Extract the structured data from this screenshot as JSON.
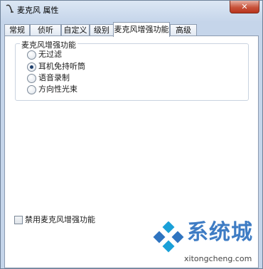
{
  "window": {
    "title": "麦克风 属性",
    "close_label": "✕"
  },
  "tabs": [
    {
      "label": "常规"
    },
    {
      "label": "侦听"
    },
    {
      "label": "自定义"
    },
    {
      "label": "级别"
    },
    {
      "label": "麦克风增强功能",
      "active": true
    },
    {
      "label": "高级"
    }
  ],
  "group": {
    "title": "麦克风增强功能",
    "options": [
      {
        "label": "无过滤",
        "checked": false
      },
      {
        "label": "耳机免持听筒",
        "checked": true
      },
      {
        "label": "语音录制",
        "checked": false
      },
      {
        "label": "方向性光束",
        "checked": false
      }
    ]
  },
  "disable_checkbox": {
    "label": "禁用麦克风增强功能",
    "checked": false
  },
  "watermark": {
    "name": "系统城",
    "url": "xitongcheng.com",
    "colors": [
      "#2f74c0",
      "#1aa0d8"
    ]
  }
}
